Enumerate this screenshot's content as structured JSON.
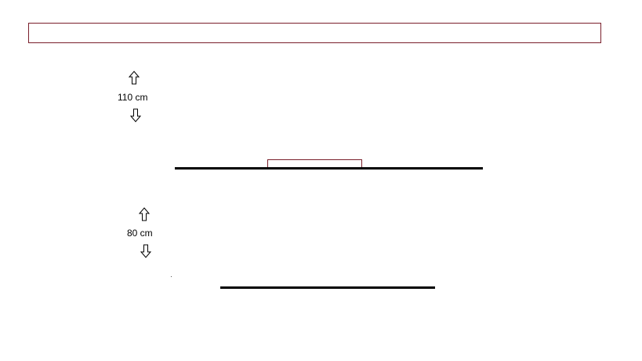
{
  "diagram": {
    "upper_measure": {
      "label": "110 cm"
    },
    "lower_measure": {
      "label": "80 cm"
    },
    "icons": {
      "up_arrow": "outlined-up-arrow-icon",
      "down_arrow": "outlined-down-arrow-icon"
    },
    "colors": {
      "frame_border": "#7a1f2b",
      "line": "#000000"
    }
  }
}
